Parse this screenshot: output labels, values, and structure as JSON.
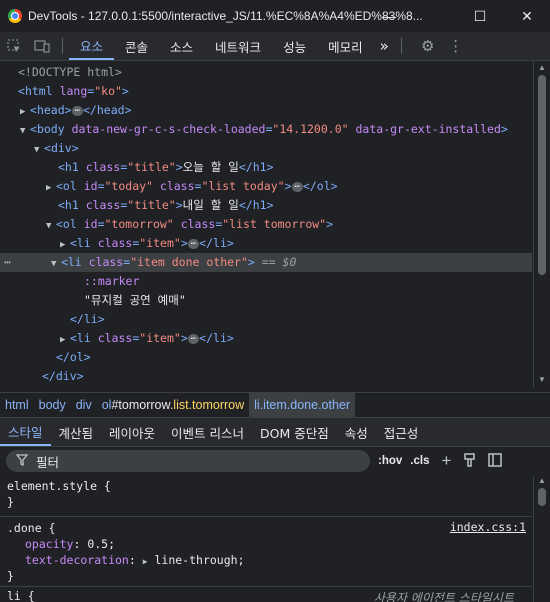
{
  "window": {
    "title": "DevTools - 127.0.0.1:5500/interactive_JS/11.%EC%8A%A4%ED%83%8..."
  },
  "toolbar": {
    "tabs": [
      "요소",
      "콘솔",
      "소스",
      "네트워크",
      "성능",
      "메모리"
    ],
    "more": "»"
  },
  "dom": {
    "doctype": "<!DOCTYPE html>",
    "html_tag": "html",
    "html_lang_attr": "lang",
    "html_lang_val": "\"ko\"",
    "head": "head",
    "body_tag": "body",
    "body_attr1": "data-new-gr-c-s-check-loaded",
    "body_val1": "\"14.1200.0\"",
    "body_attr2": "data-gr-ext-installed",
    "div": "div",
    "h1_1_text": "오늘 할 일",
    "h1_2_text": "내일 할 일",
    "ol_today_id": "\"today\"",
    "ol_today_class": "\"list today\"",
    "ol_tomorrow_id": "\"tomorrow\"",
    "ol_tomorrow_class": "\"list tomorrow\"",
    "li_class": "\"item\"",
    "li_done_class": "\"item done other\"",
    "selected_marker": "== $0",
    "marker": "::marker",
    "li_text": "\"뮤지컬 공연 예매\"",
    "title_class": "\"title\""
  },
  "breadcrumb": {
    "html": "html",
    "body": "body",
    "div": "div",
    "ol_tag": "ol",
    "ol_id": "#tomorrow",
    "ol_class": ".list.tomorrow",
    "li": "li.item.done.other"
  },
  "styles_tabs": [
    "스타일",
    "계산됨",
    "레이아웃",
    "이벤트 리스너",
    "DOM 중단점",
    "속성",
    "접근성"
  ],
  "filter": {
    "placeholder": "필터",
    "hov": ":hov",
    "cls": ".cls",
    "plus": "+"
  },
  "styles": {
    "element_style": "element.style {",
    "close": "}",
    "done_selector": ".done {",
    "done_source": "index.css:1",
    "prop1": "opacity",
    "val1": "0.5;",
    "prop2": "text-decoration",
    "val2": "line-through;",
    "li_selector": "li {",
    "ua_source": "사용자 에이전트 스타일시트"
  }
}
